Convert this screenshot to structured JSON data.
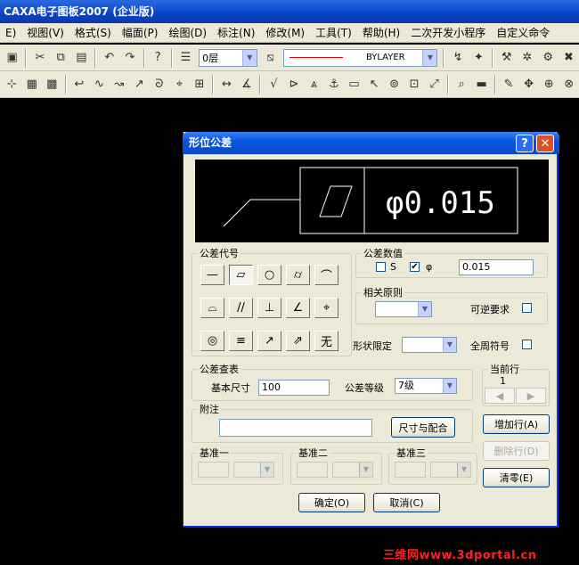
{
  "app": {
    "title": "CAXA电子图板2007 (企业版)"
  },
  "menu": [
    "E)",
    "视图(V)",
    "格式(S)",
    "幅面(P)",
    "绘图(D)",
    "标注(N)",
    "修改(M)",
    "工具(T)",
    "帮助(H)",
    "二次开发小程序",
    "自定义命令"
  ],
  "toolbar": {
    "layer_value": "0层",
    "linetype_value": "BYLAYER",
    "icons_row1": [
      "save-icon",
      "cut-icon",
      "copy-icon",
      "paste-icon",
      "undo-icon",
      "redo-icon",
      "help-icon"
    ],
    "icons_row2": [
      "snap-icon",
      "text-icon",
      "dim-icon"
    ]
  },
  "dialog": {
    "title": "形位公差",
    "help_glyph": "?",
    "close_glyph": "✕",
    "preview": {
      "symbol_text": "φ0.015"
    },
    "symbol_group": {
      "label": "公差代号",
      "symbols": [
        "—",
        "▱",
        "○",
        "⌭",
        "⌒",
        "⌓",
        "//",
        "⊥",
        "∠",
        "⌖",
        "◎",
        "≡",
        "↗",
        "⇗",
        "无"
      ]
    },
    "tol_value": {
      "label": "公差数值",
      "s_label": "S",
      "phi_label": "φ",
      "s_checked": "",
      "phi_checked": "✔",
      "value": "0.015"
    },
    "related": {
      "label": "相关原则",
      "reversible_label": "可逆要求"
    },
    "shape_limit_label": "形状限定",
    "all_around_label": "全周符号",
    "lookup": {
      "label": "公差查表",
      "basic_size_label": "基本尺寸",
      "basic_size_value": "100",
      "grade_label": "公差等级",
      "grade_value": "7级"
    },
    "current_row": {
      "label": "当前行",
      "value": "1",
      "prev": "◀",
      "next": "▶"
    },
    "note": {
      "label": "附注",
      "button": "尺寸与配合"
    },
    "datum1": {
      "label": "基准一"
    },
    "datum2": {
      "label": "基准二"
    },
    "datum3": {
      "label": "基准三"
    },
    "buttons": {
      "add_row": "增加行(A)",
      "del_row": "删除行(D)",
      "clear": "清零(E)",
      "ok": "确定(O)",
      "cancel": "取消(C)"
    }
  },
  "watermark": "三维网www.3dportal.cn"
}
